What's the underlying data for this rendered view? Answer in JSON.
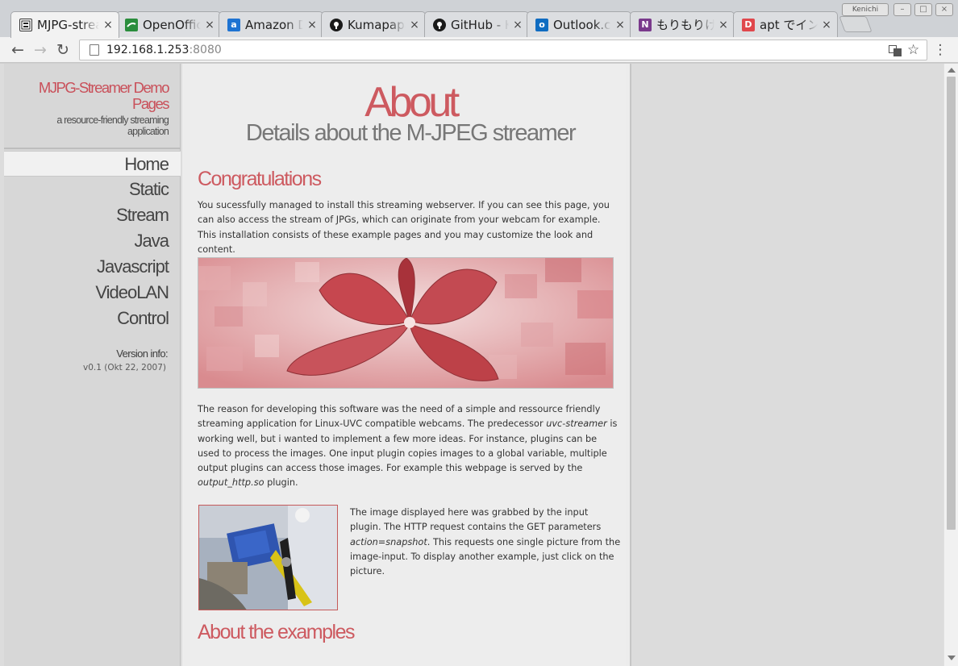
{
  "browser": {
    "tabs": [
      {
        "title": "MJPG-streamer",
        "favicon": "mjpg-icon",
        "active": true
      },
      {
        "title": "OpenOffice",
        "favicon": "openoffice-icon",
        "active": false
      },
      {
        "title": "Amazon Drive",
        "favicon": "amazon-icon",
        "active": false
      },
      {
        "title": "Kumapapa",
        "favicon": "github-icon",
        "active": false
      },
      {
        "title": "GitHub - K",
        "favicon": "github-icon",
        "active": false
      },
      {
        "title": "Outlook.com",
        "favicon": "outlook-icon",
        "active": false
      },
      {
        "title": "もりもりけん",
        "favicon": "onenote-icon",
        "active": false
      },
      {
        "title": "apt でインス",
        "favicon": "docs-icon",
        "active": false
      }
    ],
    "tab_close_glyph": "×",
    "window_user_label": "Kenichi",
    "url_host": "192.168.1.253",
    "url_port": ":8080"
  },
  "sidebar": {
    "site_title": "MJPG-Streamer Demo Pages",
    "site_subtitle": "a resource-friendly streaming application",
    "nav_items": [
      "Home",
      "Static",
      "Stream",
      "Java",
      "Javascript",
      "VideoLAN",
      "Control"
    ],
    "current_nav": "Home",
    "version_label": "Version info:",
    "version_value": "v0.1 (Okt 22, 2007)"
  },
  "content": {
    "title": "About",
    "subtitle": "Details about the M-JPEG streamer",
    "section1_heading": "Congratulations",
    "section1_text": "You sucessfully managed to install this streaming webserver. If you can see this page, you can also access the stream of JPGs, which can originate from your webcam for example. This installation consists of these example pages and you may customize the look and content.",
    "para2_a": "The reason for developing this software was the need of a simple and ressource friendly streaming application for Linux-UVC compatible webcams. The predecessor ",
    "para2_em1": "uvc-streamer",
    "para2_b": " is working well, but i wanted to implement a few more ideas. For instance, plugins can be used to process the images. One input plugin copies images to a global variable, multiple output plugins can access those images. For example this webpage is served by the ",
    "para2_em2": "output_http.so",
    "para2_c": " plugin.",
    "snapshot_a": "The image displayed here was grabbed by the input plugin. The HTTP request contains the GET parameters ",
    "snapshot_em": "action=snapshot",
    "snapshot_b": ". This requests one single picture from the image-input. To display another example, just click on the picture.",
    "section2_heading": "About the examples"
  },
  "colors": {
    "accent": "#cd5a60",
    "sidebar_bg": "#d7d7d7",
    "content_bg": "#ededed"
  }
}
